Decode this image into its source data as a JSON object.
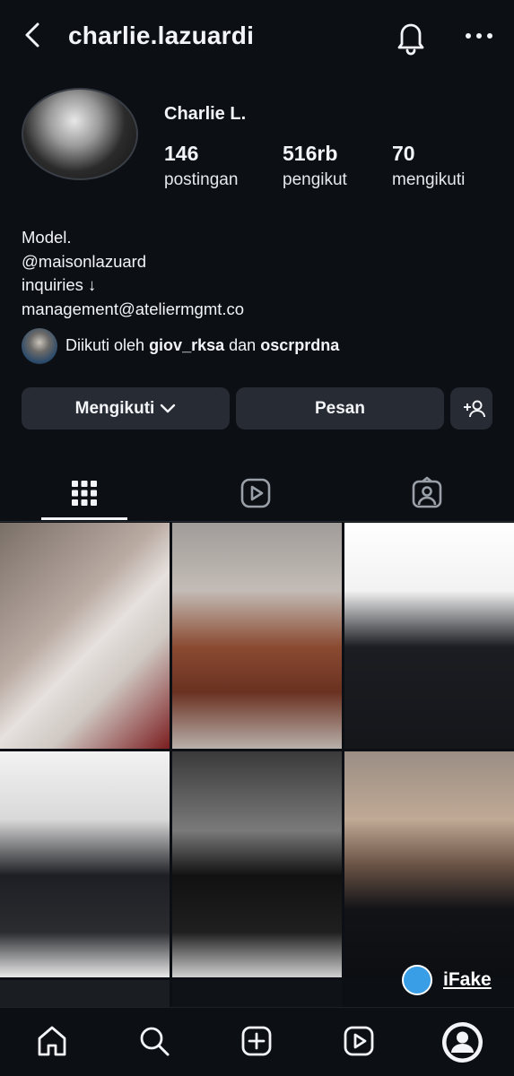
{
  "header": {
    "username": "charlie.lazuardi",
    "icons": [
      "back-icon",
      "bell-icon",
      "more-icon"
    ]
  },
  "profile": {
    "display_name": "Charlie L.",
    "stats": [
      {
        "value": "146",
        "label": "postingan"
      },
      {
        "value": "516rb",
        "label": "pengikut"
      },
      {
        "value": "70",
        "label": "mengikuti"
      }
    ],
    "bio": [
      "Model.",
      "@maisonlazuard",
      "inquiries ↓",
      "management@ateliermgmt.co"
    ],
    "followed_by": {
      "prefix": "Diikuti oleh",
      "user1": "giov_rksa",
      "conj": "dan",
      "user2": "oscrprdna"
    }
  },
  "actions": {
    "following_label": "Mengikuti",
    "message_label": "Pesan"
  },
  "tabs": [
    "grid-icon",
    "reels-icon",
    "tagged-icon"
  ],
  "watermark": {
    "text": "iFake"
  },
  "bottom_nav": [
    "home-icon",
    "search-icon",
    "create-icon",
    "reels-icon",
    "profile-avatar"
  ],
  "colors": {
    "background": "#0c0f14",
    "button": "#272b33",
    "text": "#f2f4f7"
  }
}
